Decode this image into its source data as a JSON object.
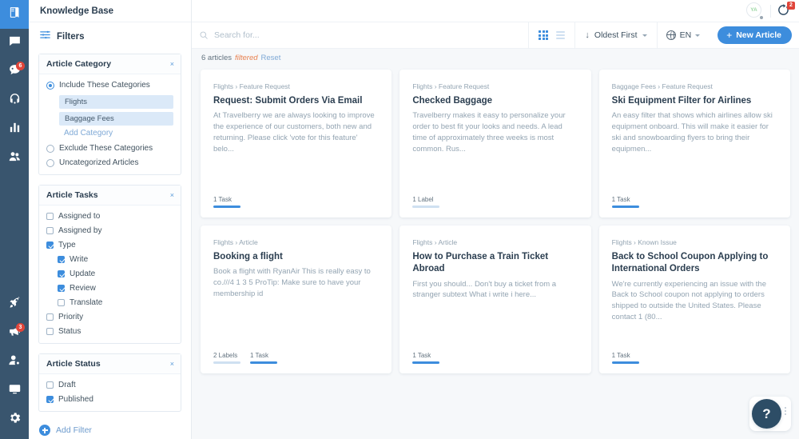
{
  "rail": {
    "items_top": [
      {
        "icon": "knowledge-base-icon",
        "name": "knowledge-base",
        "active": true,
        "badge": null
      },
      {
        "icon": "chat-icon",
        "name": "messages",
        "active": false,
        "badge": null
      },
      {
        "icon": "conversations-icon",
        "name": "conversations",
        "active": false,
        "badge": "6"
      },
      {
        "icon": "headset-icon",
        "name": "support",
        "active": false,
        "badge": null
      },
      {
        "icon": "bar-chart-icon",
        "name": "reports",
        "active": false,
        "badge": null
      },
      {
        "icon": "users-icon",
        "name": "contacts",
        "active": false,
        "badge": null
      }
    ],
    "items_bottom": [
      {
        "icon": "rocket-icon",
        "name": "whats-new",
        "active": false,
        "badge": null
      },
      {
        "icon": "megaphone-icon",
        "name": "announcements",
        "active": false,
        "badge": "3"
      },
      {
        "icon": "user-settings-icon",
        "name": "user-settings",
        "active": false,
        "badge": null
      },
      {
        "icon": "monitor-icon",
        "name": "display",
        "active": false,
        "badge": null
      },
      {
        "icon": "gear-icon",
        "name": "settings",
        "active": false,
        "badge": null
      }
    ]
  },
  "app": {
    "title": "Knowledge Base"
  },
  "filters": {
    "heading": "Filters",
    "close_label": "×",
    "add_filter_label": "Add Filter",
    "cards": [
      {
        "title": "Article Category",
        "options": [
          {
            "type": "radio",
            "label": "Include These Categories",
            "checked": true
          },
          {
            "type": "radio",
            "label": "Exclude These Categories",
            "checked": false
          },
          {
            "type": "radio",
            "label": "Uncategorized Articles",
            "checked": false
          }
        ],
        "pills": [
          "Flights",
          "Baggage Fees"
        ],
        "add_category_label": "Add Category"
      },
      {
        "title": "Article Tasks",
        "options": [
          {
            "type": "check",
            "label": "Assigned to",
            "checked": false,
            "indent": false
          },
          {
            "type": "check",
            "label": "Assigned by",
            "checked": false,
            "indent": false
          },
          {
            "type": "check",
            "label": "Type",
            "checked": true,
            "indent": false
          },
          {
            "type": "check",
            "label": "Write",
            "checked": true,
            "indent": true
          },
          {
            "type": "check",
            "label": "Update",
            "checked": true,
            "indent": true
          },
          {
            "type": "check",
            "label": "Review",
            "checked": true,
            "indent": true
          },
          {
            "type": "check",
            "label": "Translate",
            "checked": false,
            "indent": true
          },
          {
            "type": "check",
            "label": "Priority",
            "checked": false,
            "indent": false
          },
          {
            "type": "check",
            "label": "Status",
            "checked": false,
            "indent": false
          }
        ]
      },
      {
        "title": "Article Status",
        "options": [
          {
            "type": "check",
            "label": "Draft",
            "checked": false,
            "indent": false
          },
          {
            "type": "check",
            "label": "Published",
            "checked": true,
            "indent": false
          }
        ]
      }
    ]
  },
  "toolbar": {
    "search_placeholder": "Search for...",
    "search_value": "",
    "sort_label": "Oldest First",
    "language_label": "EN",
    "new_article_label": "New Article",
    "plus_glyph": "+",
    "down_arrow_glyph": "↓"
  },
  "topbar": {
    "avatar_initials": "YA",
    "notification_count": "2"
  },
  "results": {
    "count_label": "6 articles",
    "filtered_label": "filtered",
    "reset_label": "Reset"
  },
  "cards": [
    {
      "breadcrumb": "Flights › Feature Request",
      "title": "Request: Submit Orders Via Email",
      "description": "At Travelberry we are always looking to improve the experience of our customers, both new and returning. Please click 'vote for this feature' belo...",
      "badges": [
        {
          "label": "1 Task",
          "style": "blue"
        }
      ]
    },
    {
      "breadcrumb": "Flights › Feature Request",
      "title": "Checked Baggage",
      "description": "Travelberry makes it easy to personalize your order to best fit your looks and needs. A lead time of approximately three weeks is most common. Rus...",
      "badges": [
        {
          "label": "1 Label",
          "style": "light"
        }
      ]
    },
    {
      "breadcrumb": "Baggage Fees › Feature Request",
      "title": "Ski Equipment Filter for Airlines",
      "description": "An easy filter that shows which airlines allow ski equipment onboard. This will make it easier for ski and snowboarding flyers to bring their equipmen...",
      "badges": [
        {
          "label": "1 Task",
          "style": "blue"
        }
      ]
    },
    {
      "breadcrumb": "Flights › Article",
      "title": "Booking a flight",
      "description": "Book a flight with RyanAir This is really easy to co.///4 1 3 5 ProTip: Make sure to have your membership id",
      "badges": [
        {
          "label": "2 Labels",
          "style": "light"
        },
        {
          "label": "1 Task",
          "style": "blue"
        }
      ]
    },
    {
      "breadcrumb": "Flights › Article",
      "title": "How to Purchase a Train Ticket Abroad",
      "description": "First you should... Don't buy a ticket from a stranger subtext What i write i here...",
      "badges": [
        {
          "label": "1 Task",
          "style": "blue"
        }
      ]
    },
    {
      "breadcrumb": "Flights › Known Issue",
      "title": "Back to School Coupon Applying to International Orders",
      "description": "We're currently experiencing an issue with the Back to School coupon not applying to orders shipped to outside the United States. Please contact 1 (80...",
      "badges": [
        {
          "label": "1 Task",
          "style": "blue"
        }
      ]
    }
  ],
  "help": {
    "glyph": "?"
  },
  "colors": {
    "accent": "#3d8ddd",
    "rail_bg": "#39556e",
    "badge_red": "#e0453a",
    "filtered_orange": "#e8804f",
    "help_dark": "#2d4d66"
  }
}
